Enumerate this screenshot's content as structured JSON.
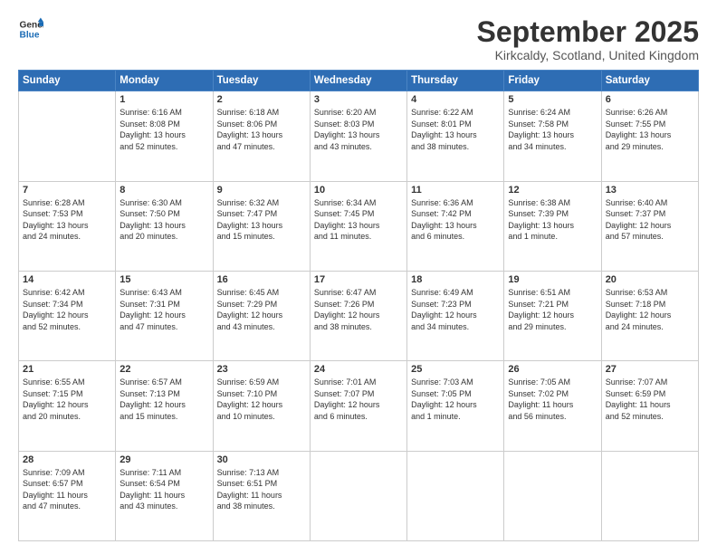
{
  "logo": {
    "line1": "General",
    "line2": "Blue"
  },
  "title": "September 2025",
  "location": "Kirkcaldy, Scotland, United Kingdom",
  "weekdays": [
    "Sunday",
    "Monday",
    "Tuesday",
    "Wednesday",
    "Thursday",
    "Friday",
    "Saturday"
  ],
  "weeks": [
    [
      {
        "day": "",
        "content": ""
      },
      {
        "day": "1",
        "content": "Sunrise: 6:16 AM\nSunset: 8:08 PM\nDaylight: 13 hours\nand 52 minutes."
      },
      {
        "day": "2",
        "content": "Sunrise: 6:18 AM\nSunset: 8:06 PM\nDaylight: 13 hours\nand 47 minutes."
      },
      {
        "day": "3",
        "content": "Sunrise: 6:20 AM\nSunset: 8:03 PM\nDaylight: 13 hours\nand 43 minutes."
      },
      {
        "day": "4",
        "content": "Sunrise: 6:22 AM\nSunset: 8:01 PM\nDaylight: 13 hours\nand 38 minutes."
      },
      {
        "day": "5",
        "content": "Sunrise: 6:24 AM\nSunset: 7:58 PM\nDaylight: 13 hours\nand 34 minutes."
      },
      {
        "day": "6",
        "content": "Sunrise: 6:26 AM\nSunset: 7:55 PM\nDaylight: 13 hours\nand 29 minutes."
      }
    ],
    [
      {
        "day": "7",
        "content": "Sunrise: 6:28 AM\nSunset: 7:53 PM\nDaylight: 13 hours\nand 24 minutes."
      },
      {
        "day": "8",
        "content": "Sunrise: 6:30 AM\nSunset: 7:50 PM\nDaylight: 13 hours\nand 20 minutes."
      },
      {
        "day": "9",
        "content": "Sunrise: 6:32 AM\nSunset: 7:47 PM\nDaylight: 13 hours\nand 15 minutes."
      },
      {
        "day": "10",
        "content": "Sunrise: 6:34 AM\nSunset: 7:45 PM\nDaylight: 13 hours\nand 11 minutes."
      },
      {
        "day": "11",
        "content": "Sunrise: 6:36 AM\nSunset: 7:42 PM\nDaylight: 13 hours\nand 6 minutes."
      },
      {
        "day": "12",
        "content": "Sunrise: 6:38 AM\nSunset: 7:39 PM\nDaylight: 13 hours\nand 1 minute."
      },
      {
        "day": "13",
        "content": "Sunrise: 6:40 AM\nSunset: 7:37 PM\nDaylight: 12 hours\nand 57 minutes."
      }
    ],
    [
      {
        "day": "14",
        "content": "Sunrise: 6:42 AM\nSunset: 7:34 PM\nDaylight: 12 hours\nand 52 minutes."
      },
      {
        "day": "15",
        "content": "Sunrise: 6:43 AM\nSunset: 7:31 PM\nDaylight: 12 hours\nand 47 minutes."
      },
      {
        "day": "16",
        "content": "Sunrise: 6:45 AM\nSunset: 7:29 PM\nDaylight: 12 hours\nand 43 minutes."
      },
      {
        "day": "17",
        "content": "Sunrise: 6:47 AM\nSunset: 7:26 PM\nDaylight: 12 hours\nand 38 minutes."
      },
      {
        "day": "18",
        "content": "Sunrise: 6:49 AM\nSunset: 7:23 PM\nDaylight: 12 hours\nand 34 minutes."
      },
      {
        "day": "19",
        "content": "Sunrise: 6:51 AM\nSunset: 7:21 PM\nDaylight: 12 hours\nand 29 minutes."
      },
      {
        "day": "20",
        "content": "Sunrise: 6:53 AM\nSunset: 7:18 PM\nDaylight: 12 hours\nand 24 minutes."
      }
    ],
    [
      {
        "day": "21",
        "content": "Sunrise: 6:55 AM\nSunset: 7:15 PM\nDaylight: 12 hours\nand 20 minutes."
      },
      {
        "day": "22",
        "content": "Sunrise: 6:57 AM\nSunset: 7:13 PM\nDaylight: 12 hours\nand 15 minutes."
      },
      {
        "day": "23",
        "content": "Sunrise: 6:59 AM\nSunset: 7:10 PM\nDaylight: 12 hours\nand 10 minutes."
      },
      {
        "day": "24",
        "content": "Sunrise: 7:01 AM\nSunset: 7:07 PM\nDaylight: 12 hours\nand 6 minutes."
      },
      {
        "day": "25",
        "content": "Sunrise: 7:03 AM\nSunset: 7:05 PM\nDaylight: 12 hours\nand 1 minute."
      },
      {
        "day": "26",
        "content": "Sunrise: 7:05 AM\nSunset: 7:02 PM\nDaylight: 11 hours\nand 56 minutes."
      },
      {
        "day": "27",
        "content": "Sunrise: 7:07 AM\nSunset: 6:59 PM\nDaylight: 11 hours\nand 52 minutes."
      }
    ],
    [
      {
        "day": "28",
        "content": "Sunrise: 7:09 AM\nSunset: 6:57 PM\nDaylight: 11 hours\nand 47 minutes."
      },
      {
        "day": "29",
        "content": "Sunrise: 7:11 AM\nSunset: 6:54 PM\nDaylight: 11 hours\nand 43 minutes."
      },
      {
        "day": "30",
        "content": "Sunrise: 7:13 AM\nSunset: 6:51 PM\nDaylight: 11 hours\nand 38 minutes."
      },
      {
        "day": "",
        "content": ""
      },
      {
        "day": "",
        "content": ""
      },
      {
        "day": "",
        "content": ""
      },
      {
        "day": "",
        "content": ""
      }
    ]
  ]
}
